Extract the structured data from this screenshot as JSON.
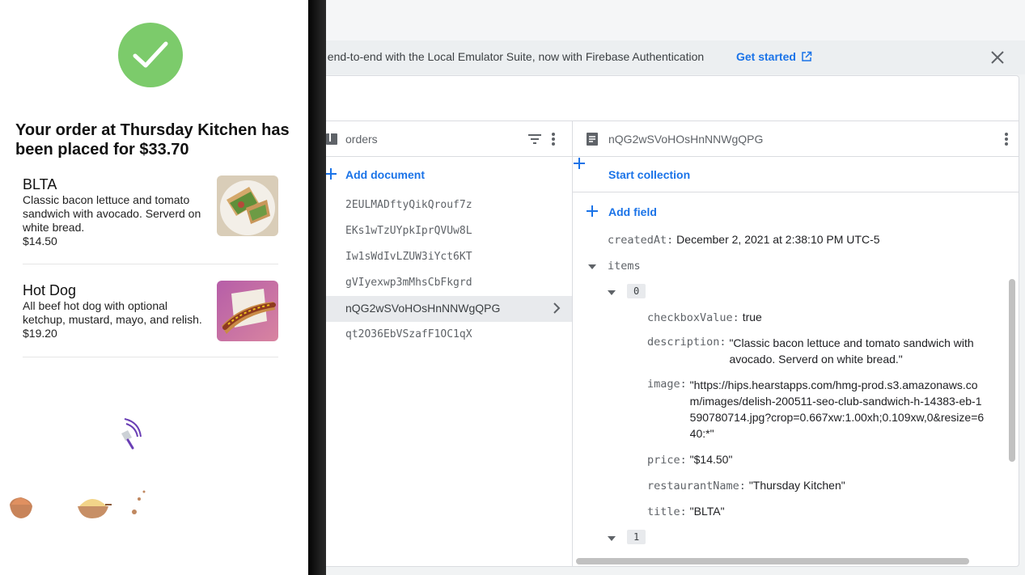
{
  "console": {
    "banner_text": "st end-to-end with the Local Emulator Suite, now with Firebase Authentication",
    "banner_link": "Get started",
    "orders_column": {
      "title": "orders",
      "add_document": "Add document",
      "documents": [
        "2EULMADftyQikQrouf7z",
        "EKs1wTzUYpkIprQVUw8L",
        "Iw1sWdIvLZUW3iYct6KT",
        "gVIyexwp3mMhsCbFkgrd",
        "nQG2wSVoHOsHnNNWgQPG",
        "qt2O36EbVSzafF1OC1qX"
      ],
      "selected_index": 4
    },
    "document": {
      "title": "nQG2wSVoHOsHnNNWgQPG",
      "start_collection": "Start collection",
      "add_field": "Add field",
      "created_key": "createdAt:",
      "created_val": "December 2, 2021 at 2:38:10 PM UTC-5",
      "items_key": "items",
      "idx0": "0",
      "idx1": "1",
      "checkbox_key": "checkboxValue:",
      "checkbox_val": "true",
      "desc_key": "description:",
      "desc_val": "\"Classic bacon lettuce and tomato sandwich with avocado. Serverd on white bread.\"",
      "image_key": "image:",
      "image_val": "\"https://hips.hearstapps.com/hmg-prod.s3.amazonaws.com/images/delish-200511-seo-club-sandwich-h-14383-eb-1590780714.jpg?crop=0.667xw:1.00xh;0.109xw,0&resize=640:*\"",
      "price_key": "price:",
      "price_val": "\"$14.50\"",
      "restaurant_key": "restaurantName:",
      "restaurant_val": "\"Thursday Kitchen\"",
      "title_key": "title:",
      "title_val": "\"BLTA\""
    }
  },
  "phone": {
    "headline": "Your order at Thursday Kitchen has been placed for $33.70",
    "items": [
      {
        "title": "BLTA",
        "description": "Classic bacon lettuce and tomato sandwich with avocado. Serverd on white bread.",
        "price": "$14.50"
      },
      {
        "title": "Hot Dog",
        "description": "All beef hot dog with optional ketchup, mustard, mayo, and relish.",
        "price": "$19.20"
      }
    ]
  },
  "colors": {
    "accent": "#1a73e8",
    "success": "#7ccb6b"
  }
}
